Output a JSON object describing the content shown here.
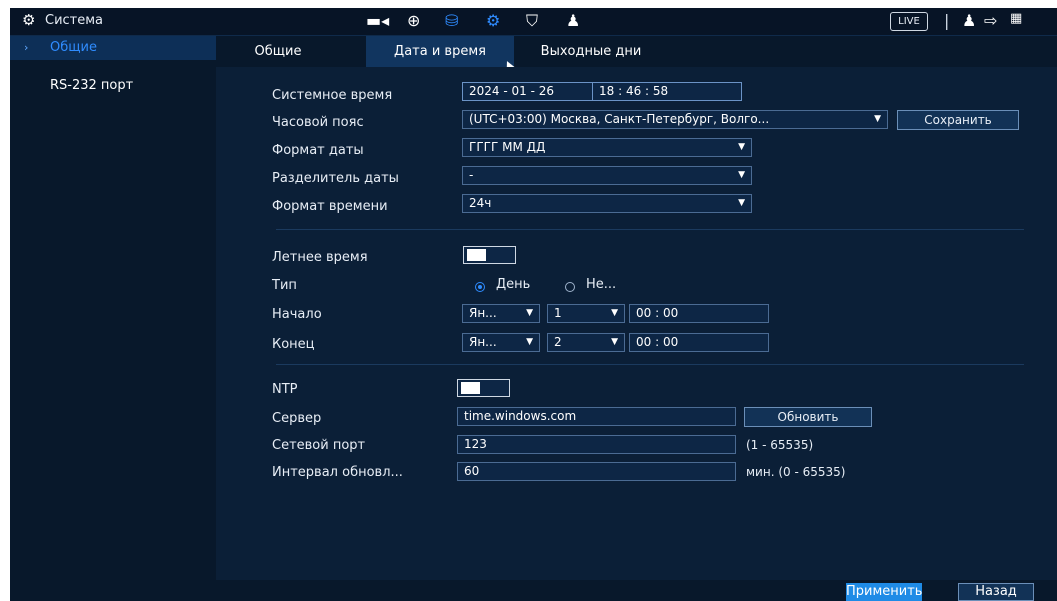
{
  "topbar": {
    "title": "Система",
    "gear_icon": "gear-icon",
    "live_label": "LIVE",
    "icons": [
      "camera-icon",
      "network-globe-icon",
      "storage-icon",
      "system-gear-icon",
      "shield-icon",
      "user-account-icon",
      "user-icon",
      "logout-icon",
      "qr-code-icon"
    ]
  },
  "sidebar": {
    "items": [
      {
        "label": "Общие",
        "active": true
      },
      {
        "label": "RS-232 порт",
        "active": false
      }
    ]
  },
  "tabs": [
    {
      "label": "Общие",
      "active": false
    },
    {
      "label": "Дата и время",
      "active": true
    },
    {
      "label": "Выходные дни",
      "active": false
    }
  ],
  "form": {
    "system_time": {
      "label": "Системное время",
      "date": "2024 - 01 - 26",
      "time": "18 : 46 : 58"
    },
    "timezone": {
      "label": "Часовой пояс",
      "value": "(UTC+03:00) Москва, Санкт-Петербург, Волго...",
      "save_label": "Сохранить"
    },
    "date_format": {
      "label": "Формат даты",
      "value": "ГГГГ ММ ДД"
    },
    "date_separator": {
      "label": "Разделитель даты",
      "value": "-"
    },
    "time_format": {
      "label": "Формат времени",
      "value": "24ч"
    },
    "dst": {
      "label": "Летнее время",
      "enabled": true
    },
    "type": {
      "label": "Тип",
      "option_day": "День",
      "option_week": "Не...",
      "selected": "day"
    },
    "start": {
      "label": "Начало",
      "month": "Ян...",
      "day": "1",
      "time": "00 : 00"
    },
    "end": {
      "label": "Конец",
      "month": "Ян...",
      "day": "2",
      "time": "00 : 00"
    },
    "ntp": {
      "label": "NTP",
      "enabled": true
    },
    "server": {
      "label": "Сервер",
      "value": "time.windows.com",
      "update_label": "Обновить"
    },
    "port": {
      "label": "Сетевой порт",
      "value": "123",
      "range": "(1 - 65535)"
    },
    "interval": {
      "label": "Интервал обновл...",
      "value": "60",
      "range": "мин.  (0 - 65535)"
    }
  },
  "footer": {
    "apply_label": "Применить",
    "back_label": "Назад"
  },
  "colors": {
    "background": "#0a1d33",
    "accent": "#1f8be6",
    "active_text": "#2f8cff"
  }
}
